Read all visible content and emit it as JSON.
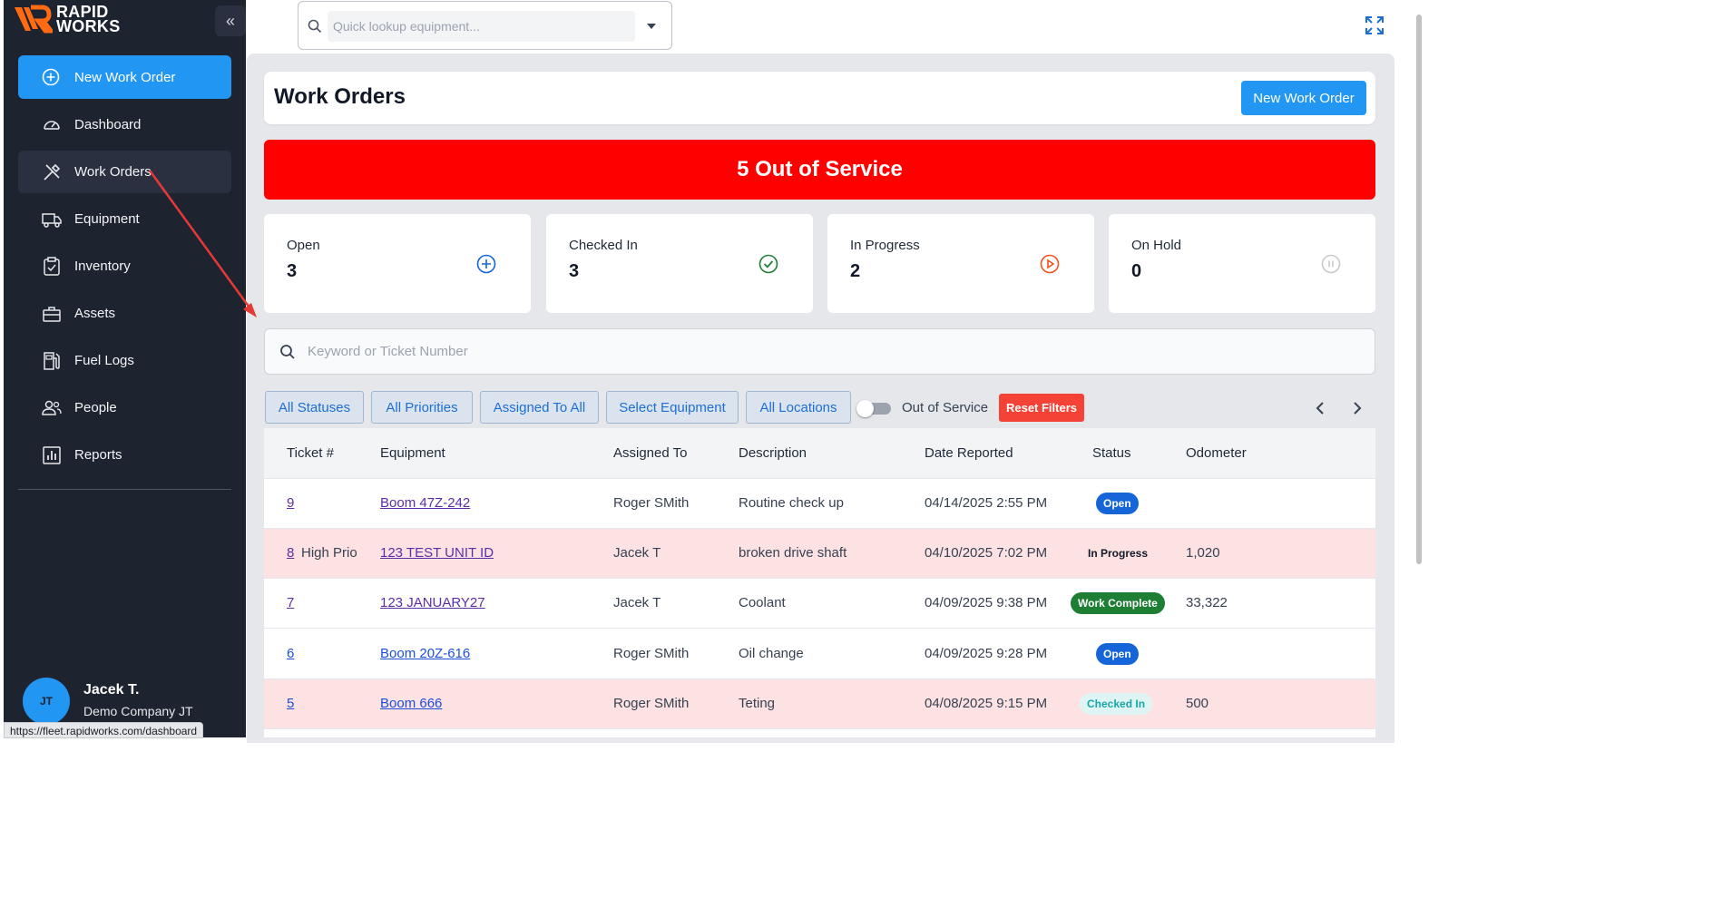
{
  "app": {
    "logo_text_line1": "RAPID",
    "logo_text_line2": "WORKS",
    "collapse_glyph": "«",
    "brand_color": "#ff6a13",
    "accent_color": "#2196f3"
  },
  "sidebar": {
    "new_work_order_label": "New Work Order",
    "items": [
      {
        "label": "Dashboard",
        "icon": "gauge-icon",
        "active": false
      },
      {
        "label": "Work Orders",
        "icon": "tools-icon",
        "active": true
      },
      {
        "label": "Equipment",
        "icon": "truck-icon",
        "active": false
      },
      {
        "label": "Inventory",
        "icon": "clipboard-check-icon",
        "active": false
      },
      {
        "label": "Assets",
        "icon": "toolbox-icon",
        "active": false
      },
      {
        "label": "Fuel Logs",
        "icon": "fuel-pump-icon",
        "active": false
      },
      {
        "label": "People",
        "icon": "people-icon",
        "active": false
      },
      {
        "label": "Reports",
        "icon": "bar-chart-icon",
        "active": false
      }
    ],
    "user": {
      "initials": "JT",
      "name": "Jacek T.",
      "company": "Demo Company JT"
    }
  },
  "browser_status_url": "https://fleet.rapidworks.com/dashboard",
  "top_search": {
    "placeholder": "Quick lookup equipment..."
  },
  "page": {
    "title": "Work Orders",
    "new_button_label": "New Work Order",
    "out_of_service_banner": "5 Out of Service"
  },
  "stats": [
    {
      "label": "Open",
      "value": "3",
      "icon": "plus-circle-icon",
      "color": "#1565d8"
    },
    {
      "label": "Checked In",
      "value": "3",
      "icon": "check-circle-icon",
      "color": "#1e7e34"
    },
    {
      "label": "In Progress",
      "value": "2",
      "icon": "play-circle-icon",
      "color": "#f4511e"
    },
    {
      "label": "On Hold",
      "value": "0",
      "icon": "pause-circle-icon",
      "color": "#c7c9cc"
    }
  ],
  "search": {
    "placeholder": "Keyword or Ticket Number"
  },
  "filters": {
    "statuses": "All Statuses",
    "priorities": "All Priorities",
    "assigned": "Assigned To All",
    "equipment": "Select Equipment",
    "locations": "All Locations",
    "out_of_service_label": "Out of Service",
    "out_of_service_on": false,
    "reset": "Reset Filters"
  },
  "table": {
    "columns": [
      "Ticket #",
      "Equipment",
      "Assigned To",
      "Description",
      "Date Reported",
      "Status",
      "Odometer"
    ],
    "rows": [
      {
        "ticket": "9",
        "priority": "",
        "equipment": "Boom 47Z-242",
        "assigned": "Roger SMith",
        "description": "Routine check up",
        "date": "04/14/2025 2:55 PM",
        "status": "Open",
        "status_kind": "open",
        "odometer": "",
        "highlight": false
      },
      {
        "ticket": "8",
        "priority": "High Priority",
        "equipment": "123 TEST UNIT ID",
        "assigned": "Jacek T",
        "description": "broken drive shaft",
        "date": "04/10/2025 7:02 PM",
        "status": "In Progress",
        "status_kind": "progress",
        "odometer": "1,020",
        "highlight": true
      },
      {
        "ticket": "7",
        "priority": "",
        "equipment": "123 JANUARY27",
        "assigned": "Jacek T",
        "description": "Coolant",
        "date": "04/09/2025 9:38 PM",
        "status": "Work Complete",
        "status_kind": "complete",
        "odometer": "33,322",
        "highlight": false
      },
      {
        "ticket": "6",
        "priority": "",
        "equipment": "Boom 20Z-616",
        "assigned": "Roger SMith",
        "description": "Oil change",
        "date": "04/09/2025 9:28 PM",
        "status": "Open",
        "status_kind": "open",
        "odometer": "",
        "highlight": false
      },
      {
        "ticket": "5",
        "priority": "",
        "equipment": "Boom 666",
        "assigned": "Roger SMith",
        "description": "Teting",
        "date": "04/08/2025 9:15 PM",
        "status": "Checked In",
        "status_kind": "checked",
        "odometer": "500",
        "highlight": true
      }
    ]
  }
}
